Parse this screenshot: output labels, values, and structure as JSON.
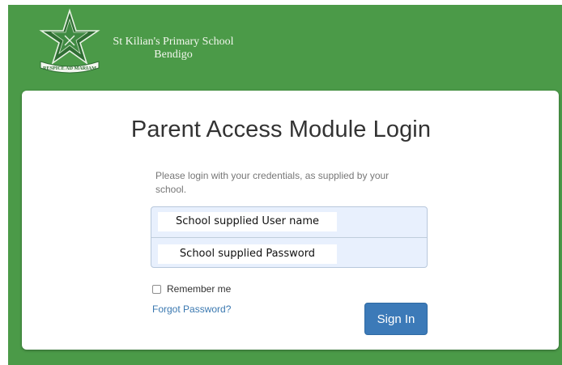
{
  "header": {
    "school_name_line1": "St Kilian's Primary School",
    "school_name_line2": "Bendigo",
    "logo_motto": "RESPICE AD MARIAM"
  },
  "login": {
    "title": "Parent Access Module Login",
    "instructions": "Please login with your credentials, as supplied by your school.",
    "username_label": "School supplied User name",
    "password_label": "School supplied Password",
    "remember_label": "Remember me",
    "remember_checked": false,
    "forgot_label": "Forgot Password?",
    "signin_label": "Sign In"
  },
  "colors": {
    "header_green": "#4b9a48",
    "button_blue": "#3c7ab8",
    "link_blue": "#3a78b0",
    "input_bg": "#e8f0fd"
  }
}
